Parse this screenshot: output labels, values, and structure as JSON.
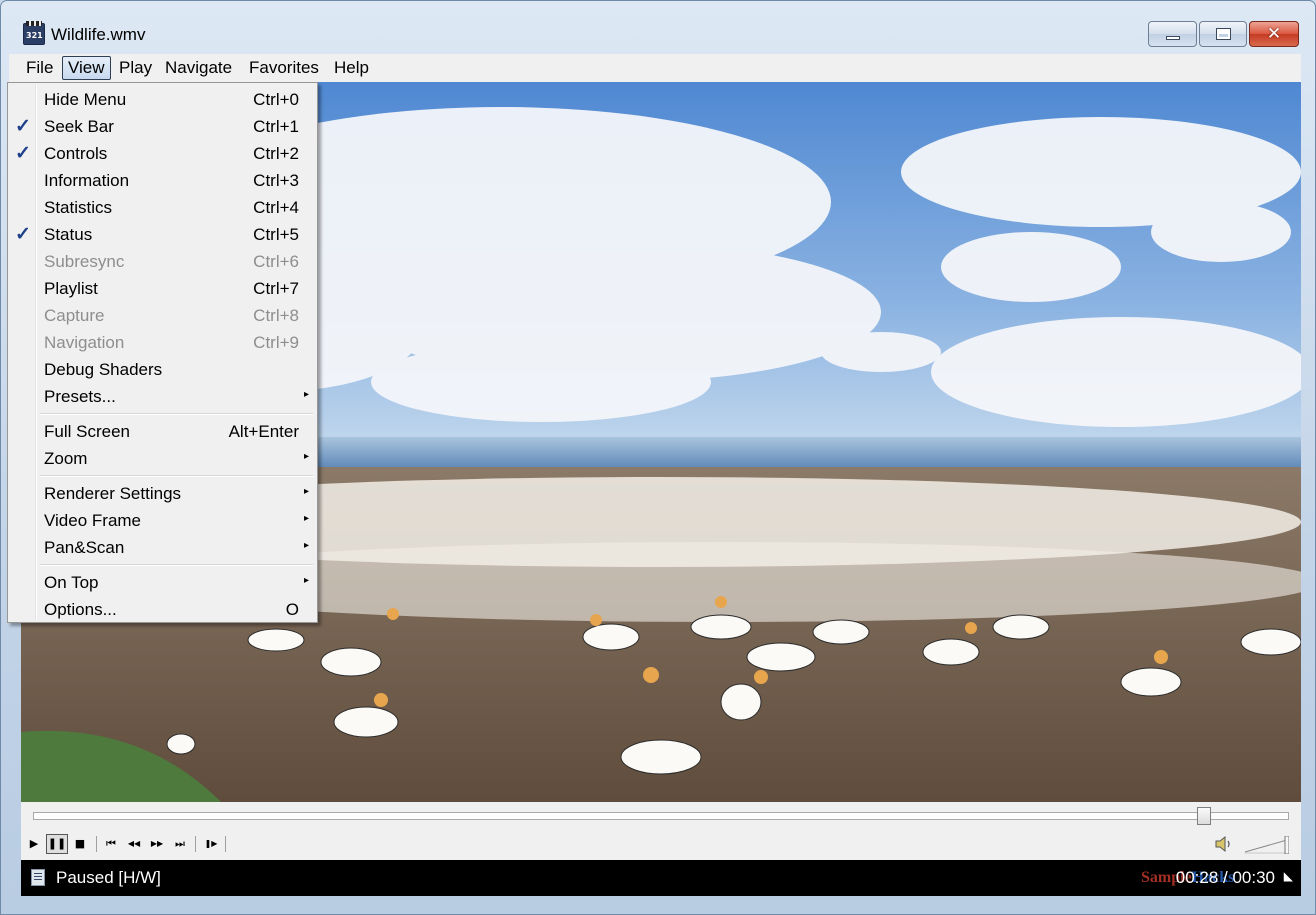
{
  "window": {
    "title": "Wildlife.wmv",
    "app_icon_text": "321",
    "close_glyph": "✕"
  },
  "menubar": {
    "items": [
      "File",
      "View",
      "Play",
      "Navigate",
      "Favorites",
      "Help"
    ],
    "active": "View"
  },
  "view_menu": {
    "items": [
      {
        "label": "Hide Menu",
        "shortcut": "Ctrl+0",
        "checked": false,
        "enabled": true
      },
      {
        "label": "Seek Bar",
        "shortcut": "Ctrl+1",
        "checked": true,
        "enabled": true
      },
      {
        "label": "Controls",
        "shortcut": "Ctrl+2",
        "checked": true,
        "enabled": true
      },
      {
        "label": "Information",
        "shortcut": "Ctrl+3",
        "checked": false,
        "enabled": true
      },
      {
        "label": "Statistics",
        "shortcut": "Ctrl+4",
        "checked": false,
        "enabled": true
      },
      {
        "label": "Status",
        "shortcut": "Ctrl+5",
        "checked": true,
        "enabled": true
      },
      {
        "label": "Subresync",
        "shortcut": "Ctrl+6",
        "checked": false,
        "enabled": false
      },
      {
        "label": "Playlist",
        "shortcut": "Ctrl+7",
        "checked": false,
        "enabled": true
      },
      {
        "label": "Capture",
        "shortcut": "Ctrl+8",
        "checked": false,
        "enabled": false
      },
      {
        "label": "Navigation",
        "shortcut": "Ctrl+9",
        "checked": false,
        "enabled": false
      },
      {
        "label": "Debug Shaders",
        "shortcut": "",
        "checked": false,
        "enabled": true
      },
      {
        "label": "Presets...",
        "shortcut": "",
        "submenu": true,
        "checked": false,
        "enabled": true
      },
      {
        "label": "Full Screen",
        "shortcut": "Alt+Enter",
        "checked": false,
        "enabled": true
      },
      {
        "label": "Zoom",
        "shortcut": "",
        "submenu": true,
        "checked": false,
        "enabled": true
      },
      {
        "label": "Renderer Settings",
        "shortcut": "",
        "submenu": true,
        "checked": false,
        "enabled": true
      },
      {
        "label": "Video Frame",
        "shortcut": "",
        "submenu": true,
        "checked": false,
        "enabled": true
      },
      {
        "label": "Pan&Scan",
        "shortcut": "",
        "submenu": true,
        "checked": false,
        "enabled": true
      },
      {
        "label": "On Top",
        "shortcut": "",
        "submenu": true,
        "checked": false,
        "enabled": true
      },
      {
        "label": "Options...",
        "shortcut": "O",
        "checked": false,
        "enabled": true
      }
    ],
    "check_glyph": "✓",
    "submenu_glyph": "▸"
  },
  "playback": {
    "seek_fraction": 0.933,
    "volume_fraction": 1.0,
    "buttons": {
      "play": "▶",
      "pause": "❚❚",
      "stop": "■",
      "prev": "⏮",
      "rewind": "◀◀",
      "forward": "▶▶",
      "next": "⏭",
      "frame_step": "❚▶"
    }
  },
  "status": {
    "text": "Paused [H/W]",
    "time": "00:28 / 00:30",
    "end_glyph": "◣"
  },
  "watermark": {
    "part1": "Sample",
    "part2": "Hacks"
  },
  "colors": {
    "sky": "#5b8fd0",
    "menu_bg": "#f0f0f0",
    "check": "#1e3f8a",
    "close_button": "#c9452c"
  }
}
